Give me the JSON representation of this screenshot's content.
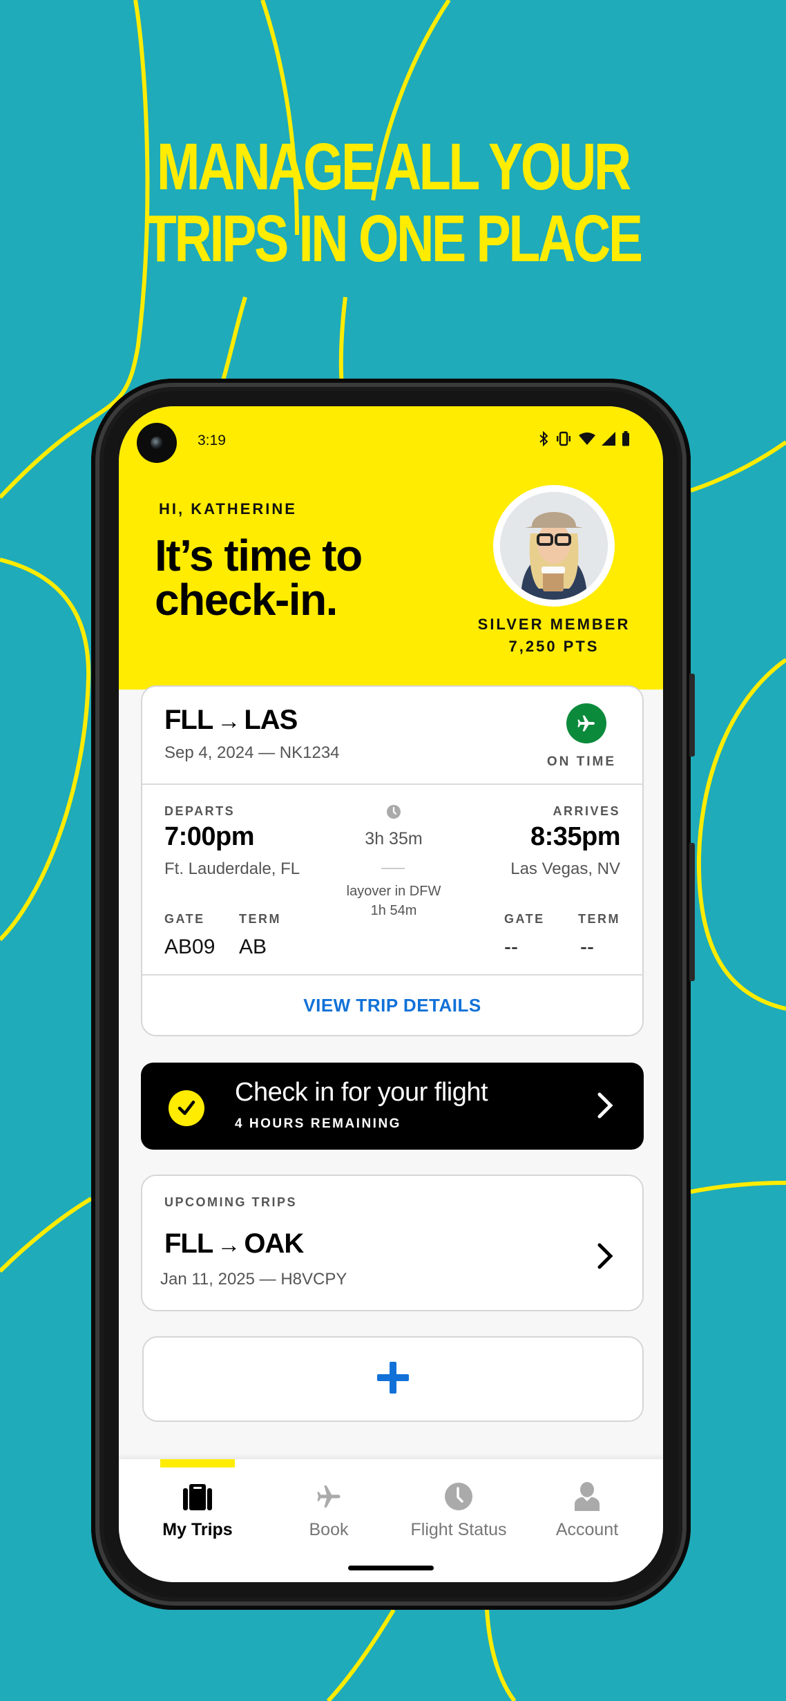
{
  "promo": {
    "line1": "MANAGE ALL YOUR",
    "line2": "TRIPS IN ONE PLACE"
  },
  "colors": {
    "background": "#1fabb9",
    "brand_yellow": "#ffec00",
    "link_blue": "#1171d8",
    "on_time_green": "#0c8a3c"
  },
  "status_bar": {
    "time": "3:19",
    "icons": [
      "bluetooth-icon",
      "vibrate-icon",
      "wifi-icon",
      "signal-icon",
      "battery-icon"
    ]
  },
  "header": {
    "greeting": "HI, KATHERINE",
    "headline": "It’s time to check-in.",
    "member_tier": "SILVER MEMBER",
    "points": "7,250 PTS"
  },
  "current_flight": {
    "origin": "FLL",
    "destination": "LAS",
    "arrow": "→",
    "date_line": "Sep 4, 2024 — NK1234",
    "status": "ON TIME",
    "departs_label": "DEPARTS",
    "departs_time": "7:00pm",
    "departs_city": "Ft. Lauderdale, FL",
    "arrives_label": "ARRIVES",
    "arrives_time": "8:35pm",
    "arrives_city": "Las Vegas, NV",
    "duration": "3h 35m",
    "layover_line1": "layover in DFW",
    "layover_line2": "1h 54m",
    "gate_label": "GATE",
    "term_label": "TERM",
    "dep_gate": "AB09",
    "dep_term": "AB",
    "arr_gate": "--",
    "arr_term": "--",
    "view_details": "VIEW TRIP DETAILS"
  },
  "checkin": {
    "title": "Check in for your flight",
    "subtitle": "4 HOURS REMAINING"
  },
  "upcoming": {
    "label": "UPCOMING TRIPS",
    "origin": "FLL",
    "destination": "OAK",
    "arrow": "→",
    "date_line": "Jan 11, 2025 — H8VCPY"
  },
  "add_trip": {
    "icon": "plus-icon"
  },
  "bottom_nav": {
    "items": [
      {
        "label": "My Trips",
        "icon": "suitcase-icon",
        "active": true
      },
      {
        "label": "Book",
        "icon": "plane-icon",
        "active": false
      },
      {
        "label": "Flight Status",
        "icon": "clock-icon",
        "active": false
      },
      {
        "label": "Account",
        "icon": "person-icon",
        "active": false
      }
    ]
  }
}
